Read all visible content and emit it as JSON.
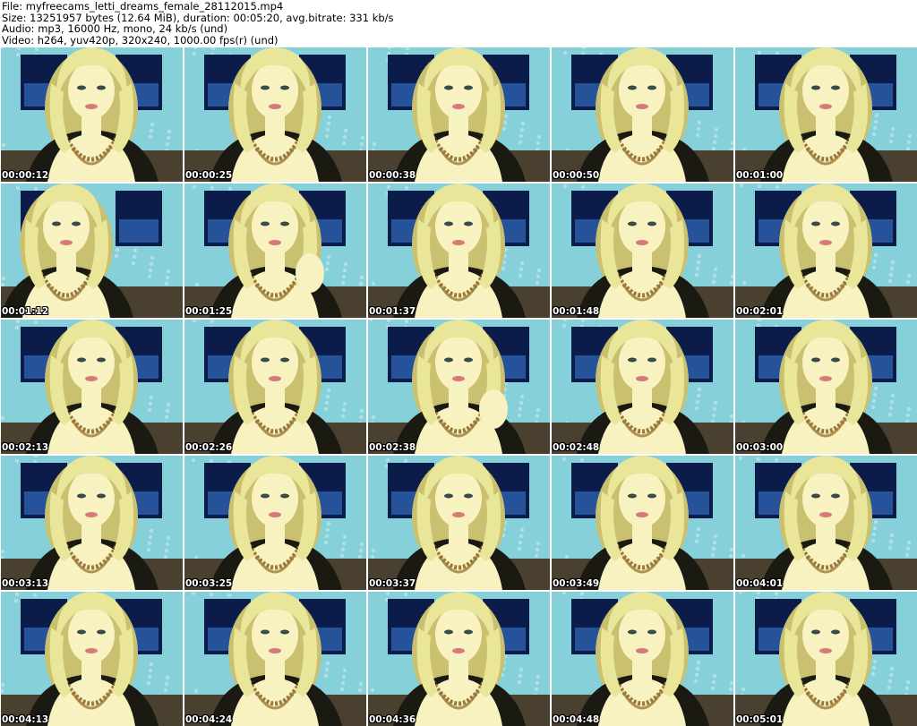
{
  "header": {
    "file": "File: myfreecams_letti_dreams_female_28112015.mp4",
    "size": "Size: 13251957 bytes (12.64 MiB), duration: 00:05:20, avg.bitrate: 331 kb/s",
    "audio": "Audio: mp3, 16000 Hz, mono, 24 kb/s (und)",
    "video": "Video: h264, yuv420p, 320x240, 1000.00 fps(r) (und)"
  },
  "thumbnails": [
    {
      "timestamp": "00:00:12",
      "head_offset": 0,
      "hand": false
    },
    {
      "timestamp": "00:00:25",
      "head_offset": 0,
      "hand": false
    },
    {
      "timestamp": "00:00:38",
      "head_offset": 0,
      "hand": false
    },
    {
      "timestamp": "00:00:50",
      "head_offset": 0,
      "hand": false
    },
    {
      "timestamp": "00:01:00",
      "head_offset": 0,
      "hand": false
    },
    {
      "timestamp": "00:01:12",
      "head_offset": -1,
      "hand": false
    },
    {
      "timestamp": "00:01:25",
      "head_offset": 0,
      "hand": true
    },
    {
      "timestamp": "00:01:37",
      "head_offset": 0,
      "hand": false
    },
    {
      "timestamp": "00:01:48",
      "head_offset": 0,
      "hand": false
    },
    {
      "timestamp": "00:02:01",
      "head_offset": 0,
      "hand": false
    },
    {
      "timestamp": "00:02:13",
      "head_offset": 0,
      "hand": false
    },
    {
      "timestamp": "00:02:26",
      "head_offset": 0,
      "hand": false
    },
    {
      "timestamp": "00:02:38",
      "head_offset": 0,
      "hand": true
    },
    {
      "timestamp": "00:02:48",
      "head_offset": 0,
      "hand": false
    },
    {
      "timestamp": "00:03:00",
      "head_offset": 0,
      "hand": false
    },
    {
      "timestamp": "00:03:13",
      "head_offset": 0,
      "hand": false
    },
    {
      "timestamp": "00:03:25",
      "head_offset": 0,
      "hand": false
    },
    {
      "timestamp": "00:03:37",
      "head_offset": 0,
      "hand": false
    },
    {
      "timestamp": "00:03:49",
      "head_offset": 0,
      "hand": false
    },
    {
      "timestamp": "00:04:01",
      "head_offset": 0,
      "hand": false
    },
    {
      "timestamp": "00:04:13",
      "head_offset": 0,
      "hand": false
    },
    {
      "timestamp": "00:04:24",
      "head_offset": 0,
      "hand": false
    },
    {
      "timestamp": "00:04:36",
      "head_offset": 0,
      "hand": false
    },
    {
      "timestamp": "00:04:48",
      "head_offset": 0,
      "hand": false
    },
    {
      "timestamp": "00:05:01",
      "head_offset": 0,
      "hand": false
    }
  ],
  "colors": {
    "wall": "#8fd6df",
    "wall_dark": "#6cc0cc",
    "poster": "#0b1c4a",
    "poster_light": "#3c7fd8",
    "sofa": "#4a4030",
    "hair": "#e9e69a",
    "hair_shade": "#c9c070",
    "skin": "#f7f2c0",
    "top": "#1a1a12",
    "necklace": "#9a7a3a"
  }
}
